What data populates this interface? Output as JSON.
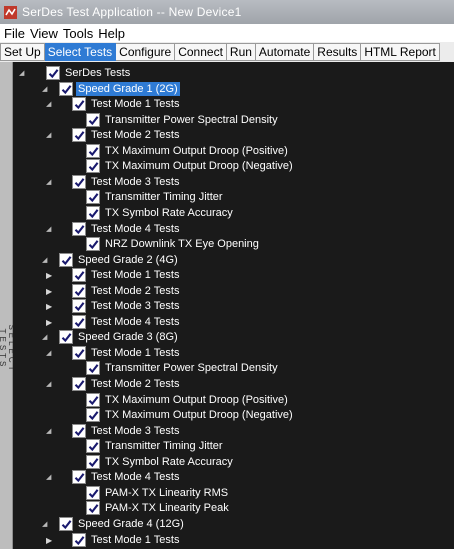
{
  "window": {
    "title": "SerDes Test Application -- New Device1",
    "app_icon": "serdes-app-icon"
  },
  "menu": [
    "File",
    "View",
    "Tools",
    "Help"
  ],
  "tabs": [
    {
      "label": "Set Up",
      "active": false
    },
    {
      "label": "Select Tests",
      "active": true
    },
    {
      "label": "Configure",
      "active": false
    },
    {
      "label": "Connect",
      "active": false
    },
    {
      "label": "Run",
      "active": false
    },
    {
      "label": "Automate",
      "active": false
    },
    {
      "label": "Results",
      "active": false
    },
    {
      "label": "HTML Report",
      "active": false
    }
  ],
  "sidebar": {
    "label": "SELECT TESTS"
  },
  "colors": {
    "accent": "#2f7bd4",
    "tree_background": "#1a1a1a",
    "text": "#ffffff",
    "checkmark": "#1a1a6e"
  },
  "tree": [
    {
      "label": "SerDes Tests",
      "level": 0,
      "expander": "expanded",
      "checked": true,
      "selected": false
    },
    {
      "label": "Speed Grade 1 (2G)",
      "level": 1,
      "expander": "expanded",
      "checked": true,
      "selected": true
    },
    {
      "label": "Test Mode 1 Tests",
      "level": 2,
      "expander": "expanded",
      "checked": true,
      "selected": false
    },
    {
      "label": "Transmitter Power Spectral Density",
      "level": 3,
      "expander": "none",
      "checked": true,
      "selected": false
    },
    {
      "label": "Test Mode 2 Tests",
      "level": 2,
      "expander": "expanded",
      "checked": true,
      "selected": false
    },
    {
      "label": "TX Maximum Output Droop (Positive)",
      "level": 3,
      "expander": "none",
      "checked": true,
      "selected": false
    },
    {
      "label": "TX Maximum Output Droop (Negative)",
      "level": 3,
      "expander": "none",
      "checked": true,
      "selected": false
    },
    {
      "label": "Test Mode 3 Tests",
      "level": 2,
      "expander": "expanded",
      "checked": true,
      "selected": false
    },
    {
      "label": "Transmitter Timing Jitter",
      "level": 3,
      "expander": "none",
      "checked": true,
      "selected": false
    },
    {
      "label": "TX Symbol Rate Accuracy",
      "level": 3,
      "expander": "none",
      "checked": true,
      "selected": false
    },
    {
      "label": "Test Mode 4 Tests",
      "level": 2,
      "expander": "expanded",
      "checked": true,
      "selected": false
    },
    {
      "label": "NRZ Downlink TX Eye Opening",
      "level": 3,
      "expander": "none",
      "checked": true,
      "selected": false
    },
    {
      "label": "Speed Grade 2  (4G)",
      "level": 1,
      "expander": "expanded",
      "checked": true,
      "selected": false
    },
    {
      "label": "Test Mode 1 Tests",
      "level": 2,
      "expander": "collapsed",
      "checked": true,
      "selected": false
    },
    {
      "label": "Test Mode 2 Tests",
      "level": 2,
      "expander": "collapsed",
      "checked": true,
      "selected": false
    },
    {
      "label": "Test Mode 3 Tests",
      "level": 2,
      "expander": "collapsed",
      "checked": true,
      "selected": false
    },
    {
      "label": "Test Mode 4 Tests",
      "level": 2,
      "expander": "collapsed",
      "checked": true,
      "selected": false
    },
    {
      "label": "Speed Grade 3  (8G)",
      "level": 1,
      "expander": "expanded",
      "checked": true,
      "selected": false
    },
    {
      "label": "Test Mode 1 Tests",
      "level": 2,
      "expander": "expanded",
      "checked": true,
      "selected": false
    },
    {
      "label": "Transmitter Power Spectral Density",
      "level": 3,
      "expander": "none",
      "checked": true,
      "selected": false
    },
    {
      "label": "Test Mode 2 Tests",
      "level": 2,
      "expander": "expanded",
      "checked": true,
      "selected": false
    },
    {
      "label": "TX Maximum Output Droop (Positive)",
      "level": 3,
      "expander": "none",
      "checked": true,
      "selected": false
    },
    {
      "label": "TX Maximum Output Droop (Negative)",
      "level": 3,
      "expander": "none",
      "checked": true,
      "selected": false
    },
    {
      "label": "Test Mode 3 Tests",
      "level": 2,
      "expander": "expanded",
      "checked": true,
      "selected": false
    },
    {
      "label": "Transmitter Timing Jitter",
      "level": 3,
      "expander": "none",
      "checked": true,
      "selected": false
    },
    {
      "label": "TX Symbol Rate Accuracy",
      "level": 3,
      "expander": "none",
      "checked": true,
      "selected": false
    },
    {
      "label": "Test Mode 4 Tests",
      "level": 2,
      "expander": "expanded",
      "checked": true,
      "selected": false
    },
    {
      "label": "PAM-X TX Linearity  RMS",
      "level": 3,
      "expander": "none",
      "checked": true,
      "selected": false
    },
    {
      "label": "PAM-X TX Linearity Peak",
      "level": 3,
      "expander": "none",
      "checked": true,
      "selected": false
    },
    {
      "label": "Speed Grade 4  (12G)",
      "level": 1,
      "expander": "expanded",
      "checked": true,
      "selected": false
    },
    {
      "label": "Test Mode 1 Tests",
      "level": 2,
      "expander": "collapsed",
      "checked": true,
      "selected": false
    }
  ]
}
